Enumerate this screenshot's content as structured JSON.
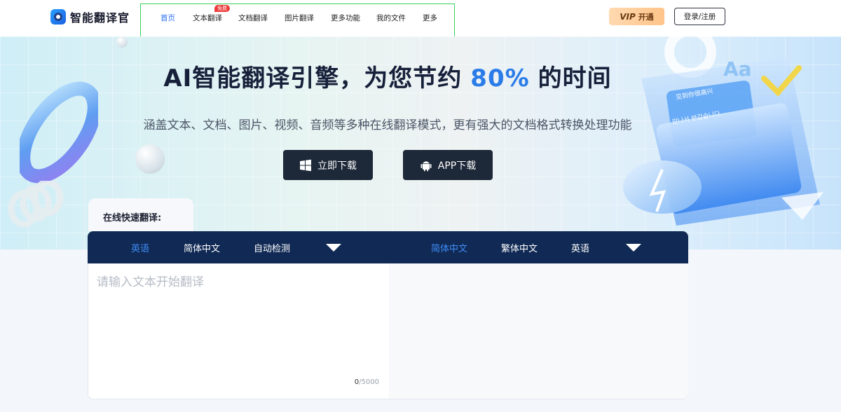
{
  "header": {
    "logo_text": "智能翻译官",
    "nav": [
      {
        "label": "首页",
        "active": true
      },
      {
        "label": "文本翻译",
        "active": false,
        "badge": "免费"
      },
      {
        "label": "文档翻译",
        "active": false
      },
      {
        "label": "图片翻译",
        "active": false
      },
      {
        "label": "更多功能",
        "active": false
      },
      {
        "label": "我的文件",
        "active": false
      },
      {
        "label": "更多",
        "active": false
      }
    ],
    "vip": {
      "prefix": "VIP",
      "label": "开通"
    },
    "login_label": "登录/注册"
  },
  "hero": {
    "title_before": "AI智能翻译引擎，为您节约",
    "title_accent": "80%",
    "title_after": "的时间",
    "subtitle": "涵盖文本、文档、图片、视频、音频等多种在线翻译模式，更有强大的文档格式转换处理功能",
    "download_windows": "立即下载",
    "download_app": "APP下载",
    "card_text_1": "见到你很高兴",
    "card_text_2": "만나서 반갑습니다.",
    "card_text_3": "Aa"
  },
  "translate": {
    "tab_label": "在线快速翻译:",
    "source_langs": [
      {
        "label": "英语",
        "active": true
      },
      {
        "label": "简体中文",
        "active": false
      },
      {
        "label": "自动检测",
        "active": false
      }
    ],
    "target_langs": [
      {
        "label": "简体中文",
        "active": true
      },
      {
        "label": "繁体中文",
        "active": false
      },
      {
        "label": "英语",
        "active": false
      }
    ],
    "placeholder": "请输入文本开始翻译",
    "count_current": "0",
    "count_max": "/5000"
  },
  "colors": {
    "accent": "#2b7ce8",
    "nav_active": "#2b6ff2",
    "lang_bar": "#112a55",
    "button_dark": "#1d2838",
    "badge_red": "#ef3a3a"
  }
}
